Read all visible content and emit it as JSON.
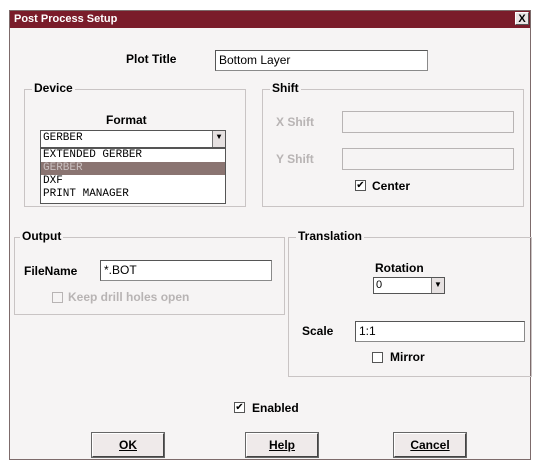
{
  "window": {
    "title": "Post Process Setup",
    "close_glyph": "X"
  },
  "plot_title": {
    "label": "Plot Title",
    "value": "Bottom Layer"
  },
  "device": {
    "group_label": "Device",
    "format_label": "Format",
    "format_selected": "GERBER",
    "format_options": [
      "EXTENDED GERBER",
      "GERBER",
      "DXF",
      "PRINT MANAGER"
    ],
    "highlighted_index": 1
  },
  "shift": {
    "group_label": "Shift",
    "x_label": "X Shift",
    "y_label": "Y Shift",
    "x_value": "",
    "y_value": "",
    "center_label": "Center",
    "center_checked": true
  },
  "output": {
    "group_label": "Output",
    "filename_label": "FileName",
    "filename_value": "*.BOT",
    "keep_drill_label": "Keep drill holes open",
    "keep_drill_checked": false
  },
  "translation": {
    "group_label": "Translation",
    "rotation_label": "Rotation",
    "rotation_value": "0",
    "scale_label": "Scale",
    "scale_value": "1:1",
    "mirror_label": "Mirror",
    "mirror_checked": false
  },
  "enabled": {
    "label": "Enabled",
    "checked": true
  },
  "buttons": {
    "ok": "OK",
    "help": "Help",
    "cancel": "Cancel"
  }
}
